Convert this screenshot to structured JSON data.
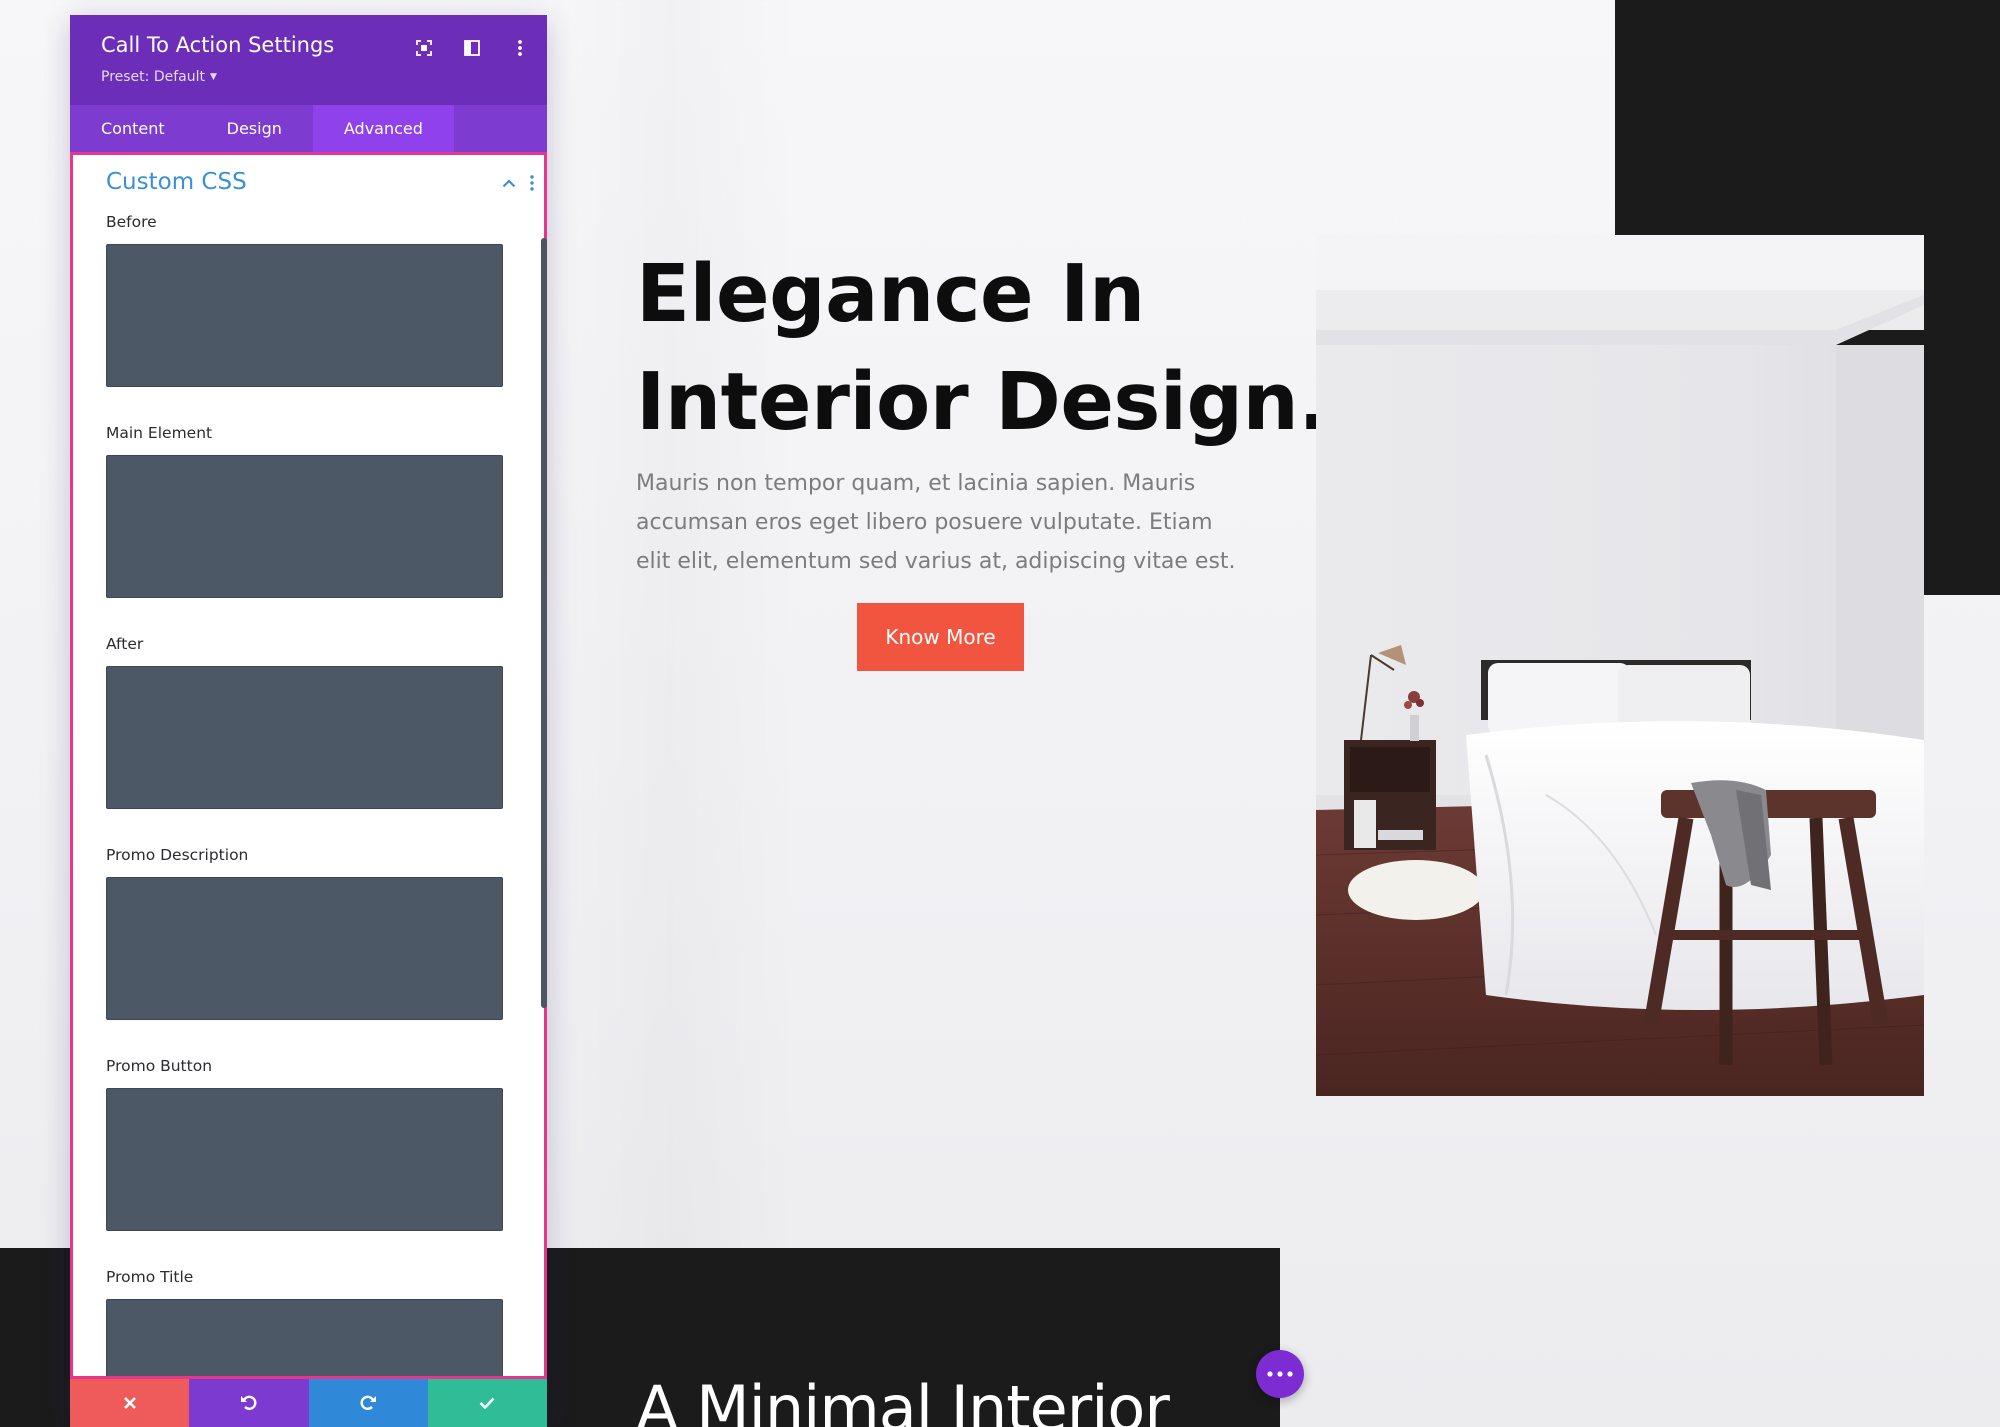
{
  "panel": {
    "title": "Call To Action Settings",
    "preset_label": "Preset: Default",
    "header_icons": [
      "fullscreen-icon",
      "sidebar-layout-icon",
      "more-vertical-icon"
    ],
    "tabs": [
      {
        "label": "Content",
        "active": false
      },
      {
        "label": "Design",
        "active": false
      },
      {
        "label": "Advanced",
        "active": true
      }
    ],
    "section": {
      "title": "Custom CSS",
      "expanded": true,
      "fields": [
        {
          "label": "Before",
          "value": ""
        },
        {
          "label": "Main Element",
          "value": ""
        },
        {
          "label": "After",
          "value": ""
        },
        {
          "label": "Promo Description",
          "value": ""
        },
        {
          "label": "Promo Button",
          "value": ""
        },
        {
          "label": "Promo Title",
          "value": ""
        }
      ]
    },
    "actions": [
      "close-icon",
      "undo-icon",
      "redo-icon",
      "check-icon"
    ]
  },
  "hero": {
    "title_line1": "Elegance In",
    "title_line2": "Interior Design.",
    "body": "Mauris non tempor quam, et lacinia sapien. Mauris accumsan eros eget libero posuere vulputate. Etiam elit elit, elementum sed varius at, adipiscing vitae est.",
    "button_label": "Know More"
  },
  "next_section": {
    "heading": "A Minimal Interior"
  },
  "colors": {
    "panel_header": "#6c2eb9",
    "panel_tabs": "#7e3bd0",
    "active_tab": "#8f42ec",
    "section_title": "#3b8fd6",
    "focus_border": "#e4368c",
    "css_box": "#4c5866",
    "cta_button": "#f1543f",
    "discard": "#ef5a5a",
    "undo": "#7c3ad0",
    "redo": "#3089d8",
    "save": "#2ebd96"
  }
}
